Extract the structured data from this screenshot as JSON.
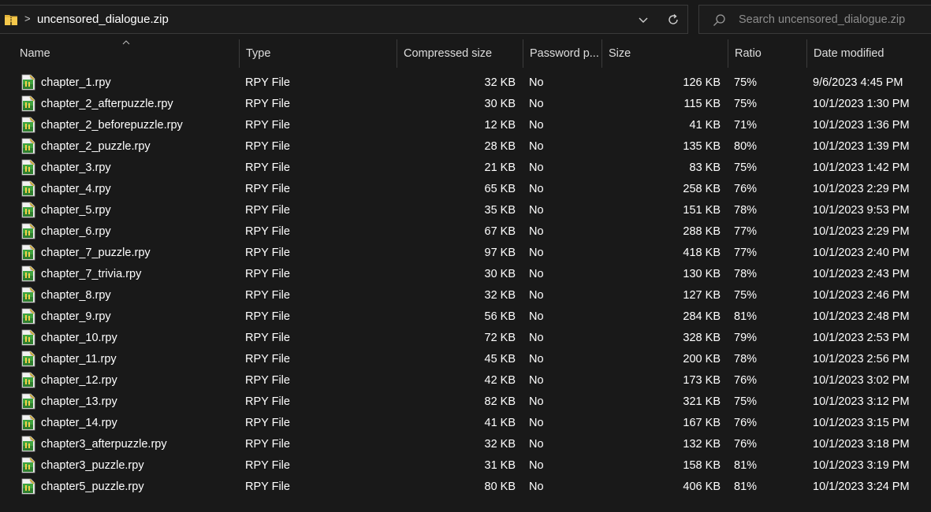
{
  "address_bar": {
    "path": "uncensored_dialogue.zip",
    "separator": ">"
  },
  "search": {
    "placeholder": "Search uncensored_dialogue.zip"
  },
  "icons": {
    "folder": "zip-folder-icon",
    "dropdown": "chevron-down-icon",
    "refresh": "refresh-icon",
    "search": "search-icon",
    "file": "rpy-file-icon",
    "sort": "sort-up-icon"
  },
  "columns": {
    "name": "Name",
    "type": "Type",
    "compressed": "Compressed size",
    "password": "Password p...",
    "size": "Size",
    "ratio": "Ratio",
    "date": "Date modified"
  },
  "files": [
    {
      "name": "chapter_1.rpy",
      "type": "RPY File",
      "compressed": "32 KB",
      "password": "No",
      "size": "126 KB",
      "ratio": "75%",
      "date": "9/6/2023 4:45 PM"
    },
    {
      "name": "chapter_2_afterpuzzle.rpy",
      "type": "RPY File",
      "compressed": "30 KB",
      "password": "No",
      "size": "115 KB",
      "ratio": "75%",
      "date": "10/1/2023 1:30 PM"
    },
    {
      "name": "chapter_2_beforepuzzle.rpy",
      "type": "RPY File",
      "compressed": "12 KB",
      "password": "No",
      "size": "41 KB",
      "ratio": "71%",
      "date": "10/1/2023 1:36 PM"
    },
    {
      "name": "chapter_2_puzzle.rpy",
      "type": "RPY File",
      "compressed": "28 KB",
      "password": "No",
      "size": "135 KB",
      "ratio": "80%",
      "date": "10/1/2023 1:39 PM"
    },
    {
      "name": "chapter_3.rpy",
      "type": "RPY File",
      "compressed": "21 KB",
      "password": "No",
      "size": "83 KB",
      "ratio": "75%",
      "date": "10/1/2023 1:42 PM"
    },
    {
      "name": "chapter_4.rpy",
      "type": "RPY File",
      "compressed": "65 KB",
      "password": "No",
      "size": "258 KB",
      "ratio": "76%",
      "date": "10/1/2023 2:29 PM"
    },
    {
      "name": "chapter_5.rpy",
      "type": "RPY File",
      "compressed": "35 KB",
      "password": "No",
      "size": "151 KB",
      "ratio": "78%",
      "date": "10/1/2023 9:53 PM"
    },
    {
      "name": "chapter_6.rpy",
      "type": "RPY File",
      "compressed": "67 KB",
      "password": "No",
      "size": "288 KB",
      "ratio": "77%",
      "date": "10/1/2023 2:29 PM"
    },
    {
      "name": "chapter_7_puzzle.rpy",
      "type": "RPY File",
      "compressed": "97 KB",
      "password": "No",
      "size": "418 KB",
      "ratio": "77%",
      "date": "10/1/2023 2:40 PM"
    },
    {
      "name": "chapter_7_trivia.rpy",
      "type": "RPY File",
      "compressed": "30 KB",
      "password": "No",
      "size": "130 KB",
      "ratio": "78%",
      "date": "10/1/2023 2:43 PM"
    },
    {
      "name": "chapter_8.rpy",
      "type": "RPY File",
      "compressed": "32 KB",
      "password": "No",
      "size": "127 KB",
      "ratio": "75%",
      "date": "10/1/2023 2:46 PM"
    },
    {
      "name": "chapter_9.rpy",
      "type": "RPY File",
      "compressed": "56 KB",
      "password": "No",
      "size": "284 KB",
      "ratio": "81%",
      "date": "10/1/2023 2:48 PM"
    },
    {
      "name": "chapter_10.rpy",
      "type": "RPY File",
      "compressed": "72 KB",
      "password": "No",
      "size": "328 KB",
      "ratio": "79%",
      "date": "10/1/2023 2:53 PM"
    },
    {
      "name": "chapter_11.rpy",
      "type": "RPY File",
      "compressed": "45 KB",
      "password": "No",
      "size": "200 KB",
      "ratio": "78%",
      "date": "10/1/2023 2:56 PM"
    },
    {
      "name": "chapter_12.rpy",
      "type": "RPY File",
      "compressed": "42 KB",
      "password": "No",
      "size": "173 KB",
      "ratio": "76%",
      "date": "10/1/2023 3:02 PM"
    },
    {
      "name": "chapter_13.rpy",
      "type": "RPY File",
      "compressed": "82 KB",
      "password": "No",
      "size": "321 KB",
      "ratio": "75%",
      "date": "10/1/2023 3:12 PM"
    },
    {
      "name": "chapter_14.rpy",
      "type": "RPY File",
      "compressed": "41 KB",
      "password": "No",
      "size": "167 KB",
      "ratio": "76%",
      "date": "10/1/2023 3:15 PM"
    },
    {
      "name": "chapter3_afterpuzzle.rpy",
      "type": "RPY File",
      "compressed": "32 KB",
      "password": "No",
      "size": "132 KB",
      "ratio": "76%",
      "date": "10/1/2023 3:18 PM"
    },
    {
      "name": "chapter3_puzzle.rpy",
      "type": "RPY File",
      "compressed": "31 KB",
      "password": "No",
      "size": "158 KB",
      "ratio": "81%",
      "date": "10/1/2023 3:19 PM"
    },
    {
      "name": "chapter5_puzzle.rpy",
      "type": "RPY File",
      "compressed": "80 KB",
      "password": "No",
      "size": "406 KB",
      "ratio": "81%",
      "date": "10/1/2023 3:24 PM"
    }
  ]
}
